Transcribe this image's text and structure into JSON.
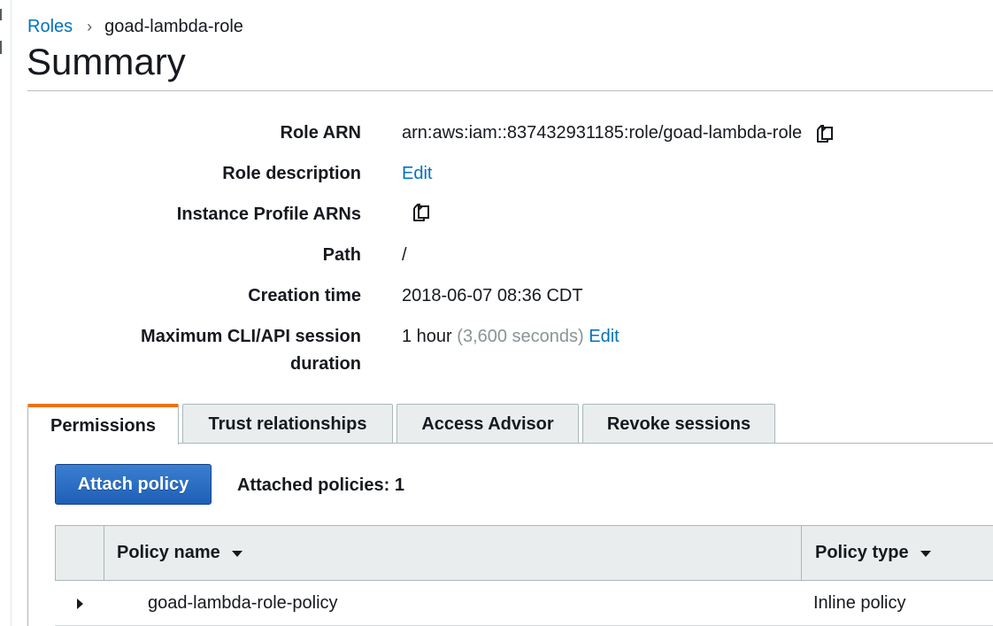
{
  "breadcrumb": {
    "parent_label": "Roles",
    "separator": "›",
    "current_label": "goad-lambda-role"
  },
  "page": {
    "title": "Summary"
  },
  "summary": {
    "role_arn": {
      "label": "Role ARN",
      "value": "arn:aws:iam::837432931185:role/goad-lambda-role",
      "icon": "copy-icon"
    },
    "role_description": {
      "label": "Role description",
      "edit_label": "Edit"
    },
    "instance_profile_arns": {
      "label": "Instance Profile ARNs",
      "icon": "copy-icon"
    },
    "path": {
      "label": "Path",
      "value": "/"
    },
    "creation_time": {
      "label": "Creation time",
      "value": "2018-06-07 08:36 CDT"
    },
    "max_session": {
      "label_line1": "Maximum CLI/API session",
      "label_line2": "duration",
      "value": "1 hour",
      "seconds": "(3,600 seconds)",
      "edit_label": "Edit"
    }
  },
  "tabs": [
    {
      "label": "Permissions",
      "active": true
    },
    {
      "label": "Trust relationships",
      "active": false
    },
    {
      "label": "Access Advisor",
      "active": false
    },
    {
      "label": "Revoke sessions",
      "active": false
    }
  ],
  "permissions": {
    "attach_button_label": "Attach policy",
    "attached_count_text": "Attached policies: 1",
    "table": {
      "columns": [
        {
          "label": "Policy name",
          "sortable": true
        },
        {
          "label": "Policy type",
          "sortable": true
        }
      ],
      "rows": [
        {
          "policy_name": "goad-lambda-role-policy",
          "policy_type": "Inline policy"
        }
      ]
    }
  },
  "colors": {
    "link": "#0073bb",
    "active_tab_accent": "#ec7211",
    "primary_button": "#1f5fb7",
    "muted_text": "#879596"
  }
}
